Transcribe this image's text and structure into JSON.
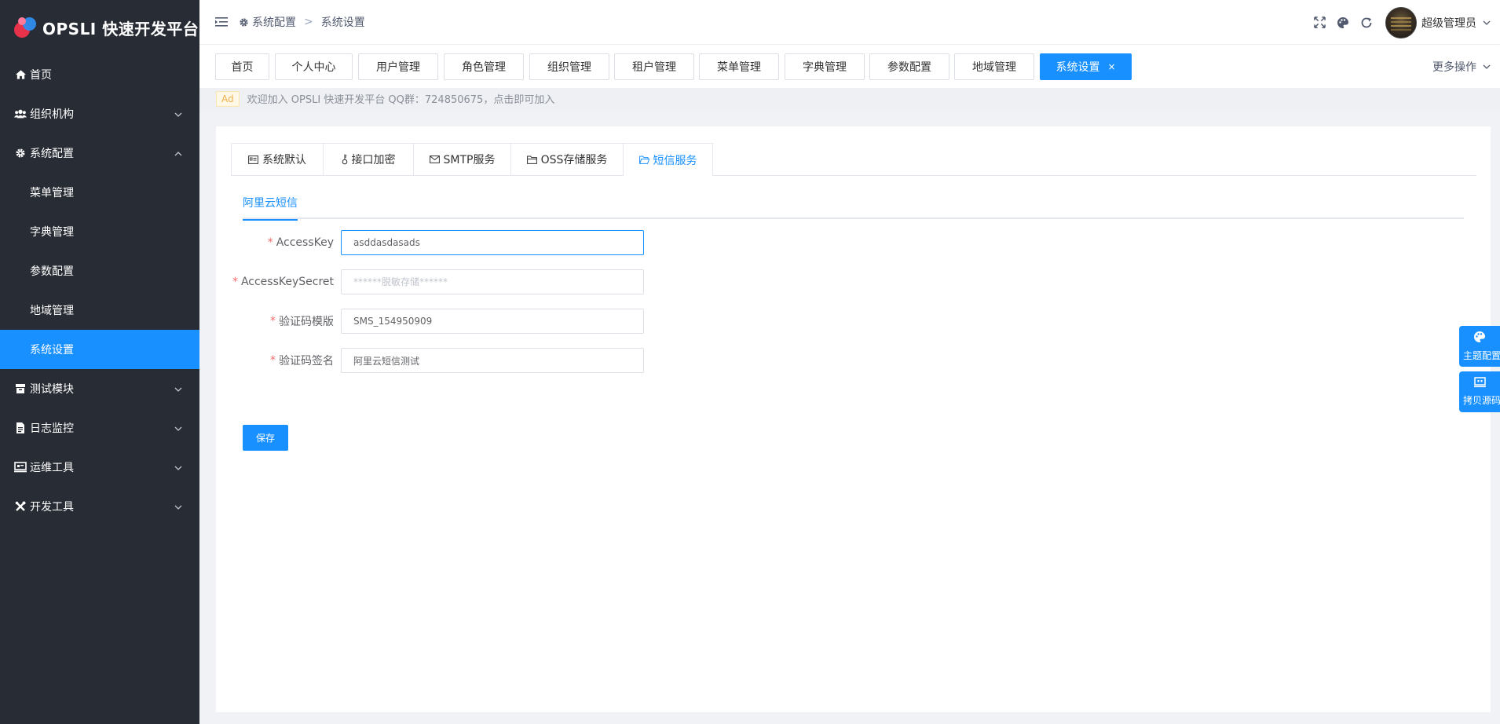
{
  "app": {
    "title": "OPSLI 快速开发平台"
  },
  "colors": {
    "sidebar_bg": "#282c34",
    "accent": "#1890ff",
    "required": "#f56c6c"
  },
  "sidebar": {
    "items": [
      {
        "label": "首页",
        "icon": "home-icon"
      },
      {
        "label": "组织机构",
        "icon": "users-icon"
      },
      {
        "label": "系统配置",
        "icon": "gear-icon"
      },
      {
        "label": "菜单管理"
      },
      {
        "label": "字典管理"
      },
      {
        "label": "参数配置"
      },
      {
        "label": "地域管理"
      },
      {
        "label": "系统设置"
      },
      {
        "label": "测试模块",
        "icon": "box-icon"
      },
      {
        "label": "日志监控",
        "icon": "file-icon"
      },
      {
        "label": "运维工具",
        "icon": "monitor-icon"
      },
      {
        "label": "开发工具",
        "icon": "tools-icon"
      }
    ]
  },
  "header": {
    "breadcrumb": [
      "系统配置",
      "系统设置"
    ],
    "user_name": "超级管理员"
  },
  "tags": {
    "items": [
      "首页",
      "个人中心",
      "用户管理",
      "角色管理",
      "组织管理",
      "租户管理",
      "菜单管理",
      "字典管理",
      "参数配置",
      "地域管理",
      "系统设置"
    ],
    "close_glyph": "×",
    "more_label": "更多操作"
  },
  "notice": {
    "badge": "Ad",
    "text": "欢迎加入 OPSLI 快速开发平台 QQ群：724850675，点击即可加入"
  },
  "settings": {
    "tabs": [
      "系统默认",
      "接口加密",
      "SMTP服务",
      "OSS存储服务",
      "短信服务"
    ],
    "subtab": "阿里云短信",
    "fields": [
      {
        "label": "AccessKey",
        "value": "asddasdasads",
        "placeholder": ""
      },
      {
        "label": "AccessKeySecret",
        "value": "",
        "placeholder": "******脱敏存储******"
      },
      {
        "label": "验证码模版",
        "value": "SMS_154950909",
        "placeholder": ""
      },
      {
        "label": "验证码签名",
        "value": "阿里云短信测试",
        "placeholder": ""
      }
    ],
    "required_mark": "*",
    "save_label": "保存"
  },
  "float_panels": [
    {
      "label": "主题配置",
      "icon": "palette-icon"
    },
    {
      "label": "拷贝源码",
      "icon": "code-icon"
    }
  ]
}
